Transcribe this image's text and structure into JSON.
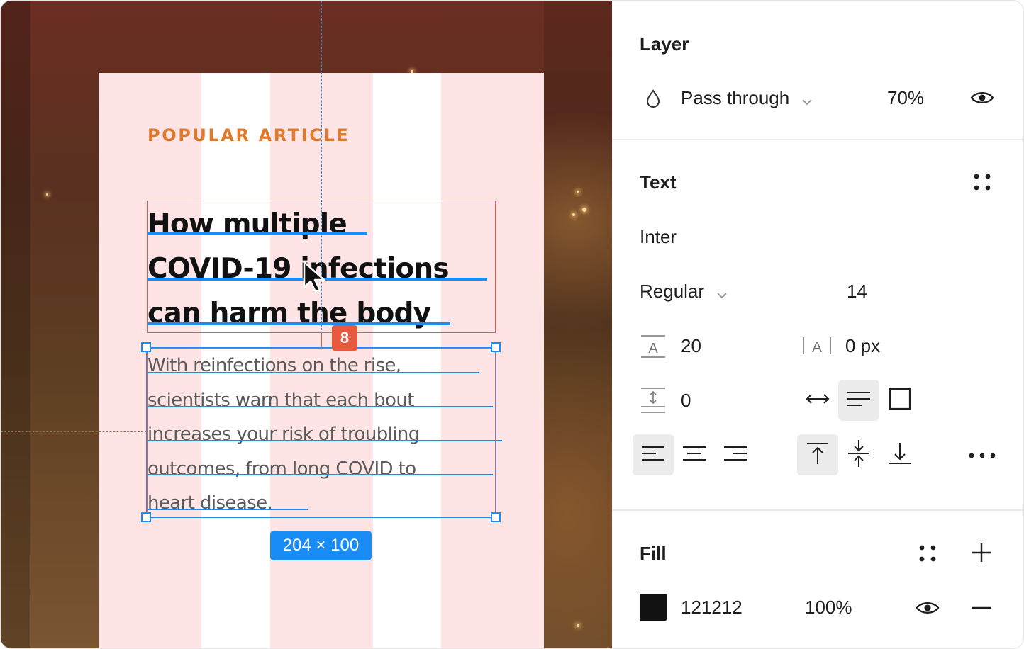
{
  "canvas": {
    "card": {
      "eyebrow": "POPULAR ARTICLE",
      "headline_lines": [
        "How multiple",
        "COVID-19 infections",
        "can harm the body"
      ],
      "body_lines": [
        "With reinfections on the rise,",
        "scientists warn that each bout",
        "increases your risk of troubling",
        "outcomes, from long COVID to",
        "heart disease."
      ]
    },
    "spacing_badge": "8",
    "size_badge": "204 × 100",
    "colors": {
      "accent_orange": "#e07a2a",
      "selection_blue": "#1a8cf5",
      "measure_red": "#e85a3d",
      "card_pink": "#ffe4e6"
    }
  },
  "panel": {
    "layer": {
      "title": "Layer",
      "blend_mode": "Pass through",
      "blend_icon": "droplet-icon",
      "opacity": "70%",
      "visibility_icon": "eye-icon"
    },
    "text": {
      "title": "Text",
      "styles_icon": "styles-grid-icon",
      "font_family": "Inter",
      "font_weight": "Regular",
      "font_size": "14",
      "line_height": "20",
      "letter_spacing": "0 px",
      "paragraph_spacing": "0",
      "resize_icons": [
        "auto-width-icon",
        "auto-height-icon",
        "fixed-size-icon"
      ],
      "align_icons": [
        "align-left-icon",
        "align-center-icon",
        "align-right-icon"
      ],
      "vertical_align_icons": [
        "align-top-icon",
        "align-middle-icon",
        "align-bottom-icon"
      ],
      "more_icon": "more-options-icon"
    },
    "fill": {
      "title": "Fill",
      "hex": "121212",
      "opacity": "100%",
      "swatch_color": "#121212"
    }
  }
}
